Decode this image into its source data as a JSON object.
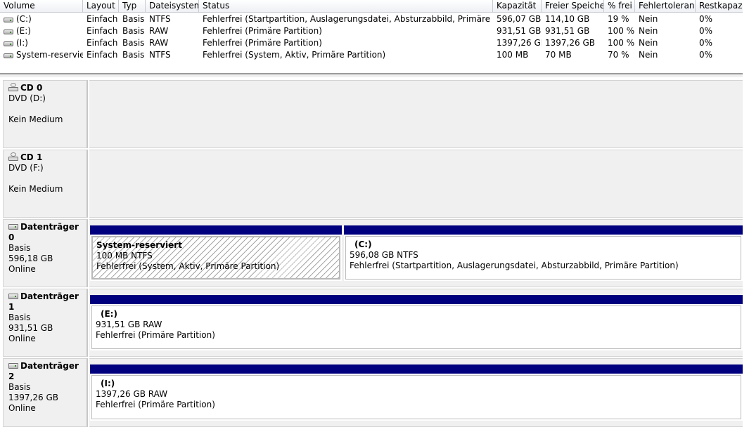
{
  "volume_list": {
    "columns": [
      "Volume",
      "Layout",
      "Typ",
      "Dateisystem",
      "Status",
      "Kapazität",
      "Freier Speicher",
      "% frei",
      "Fehlertoleranz",
      "Restkapazität"
    ],
    "rows": [
      {
        "volume": "(C:)",
        "layout": "Einfach",
        "type": "Basis",
        "fs": "NTFS",
        "status": "Fehlerfrei (Startpartition, Auslagerungsdatei, Absturzabbild, Primäre Partition)",
        "capacity": "596,07 GB",
        "free": "114,10 GB",
        "pct_free": "19 %",
        "fault_tolerance": "Nein",
        "overhead": "0%"
      },
      {
        "volume": "(E:)",
        "layout": "Einfach",
        "type": "Basis",
        "fs": "RAW",
        "status": "Fehlerfrei (Primäre Partition)",
        "capacity": "931,51 GB",
        "free": "931,51 GB",
        "pct_free": "100 %",
        "fault_tolerance": "Nein",
        "overhead": "0%"
      },
      {
        "volume": "(I:)",
        "layout": "Einfach",
        "type": "Basis",
        "fs": "RAW",
        "status": "Fehlerfrei (Primäre Partition)",
        "capacity": "1397,26 GB",
        "free": "1397,26 GB",
        "pct_free": "100 %",
        "fault_tolerance": "Nein",
        "overhead": "0%"
      },
      {
        "volume": "System-reserviert",
        "layout": "Einfach",
        "type": "Basis",
        "fs": "NTFS",
        "status": "Fehlerfrei (System, Aktiv, Primäre Partition)",
        "capacity": "100 MB",
        "free": "70 MB",
        "pct_free": "70 %",
        "fault_tolerance": "Nein",
        "overhead": "0%"
      }
    ]
  },
  "disks": [
    {
      "name": "CD 0",
      "line2": "DVD (D:)",
      "line3": "",
      "line4": "Kein Medium",
      "icon": "cd-drive-icon"
    },
    {
      "name": "CD 1",
      "line2": "DVD (F:)",
      "line3": "",
      "line4": "Kein Medium",
      "icon": "cd-drive-icon"
    },
    {
      "name": "Datenträger 0",
      "line2": "Basis",
      "line3": "596,18 GB",
      "line4": "Online",
      "icon": "hard-disk-icon",
      "partitions": [
        {
          "title": "System-reserviert",
          "size": "100 MB NTFS",
          "status": "Fehlerfrei (System, Aktiv, Primäre Partition)",
          "selected": true
        },
        {
          "title": "(C:)",
          "size": "596,08 GB NTFS",
          "status": "Fehlerfrei (Startpartition, Auslagerungsdatei, Absturzabbild, Primäre Partition)",
          "selected": false
        }
      ]
    },
    {
      "name": "Datenträger 1",
      "line2": "Basis",
      "line3": "931,51 GB",
      "line4": "Online",
      "icon": "hard-disk-icon",
      "partitions": [
        {
          "title": "(E:)",
          "size": "931,51 GB RAW",
          "status": "Fehlerfrei (Primäre Partition)",
          "selected": false
        }
      ]
    },
    {
      "name": "Datenträger 2",
      "line2": "Basis",
      "line3": "1397,26 GB",
      "line4": "Online",
      "icon": "hard-disk-icon",
      "partitions": [
        {
          "title": "(I:)",
          "size": "1397,26 GB RAW",
          "status": "Fehlerfrei (Primäre Partition)",
          "selected": false
        }
      ]
    }
  ],
  "colors": {
    "partition_bar": "#00007f",
    "panel_bg": "#f0f0f0"
  }
}
